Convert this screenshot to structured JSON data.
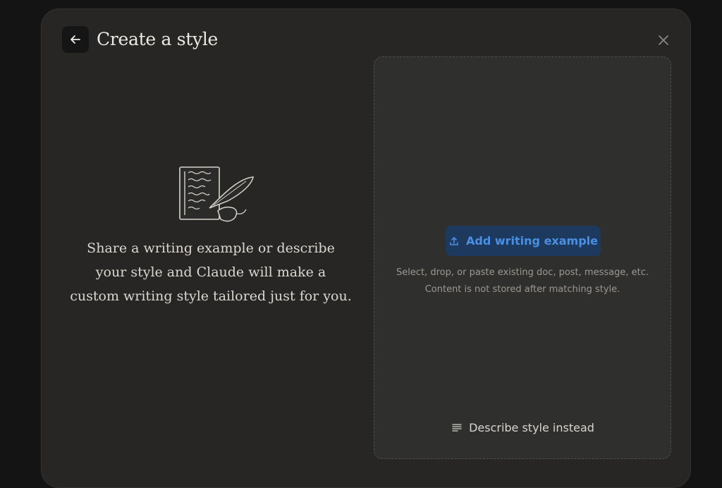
{
  "dialog": {
    "title": "Create a style",
    "back_icon": "arrow-left-icon",
    "close_icon": "close-icon"
  },
  "intro": {
    "illustration": "document-quill-illustration",
    "text": "Share a writing example or describe your style and Claude will make a custom writing style tailored just for you."
  },
  "dropzone": {
    "add_button_label": "Add writing example",
    "add_button_icon": "upload-icon",
    "hint_line1": "Select, drop, or paste existing doc, post, message, etc.",
    "hint_line2": "Content is not stored after matching style.",
    "describe_label": "Describe style instead",
    "describe_icon": "text-lines-icon"
  },
  "colors": {
    "background": "#141414",
    "modal": "#272625",
    "dropzone": "#2f2f2e",
    "accent_button_bg": "#1d3a5e",
    "accent_text": "#4a90e2"
  }
}
